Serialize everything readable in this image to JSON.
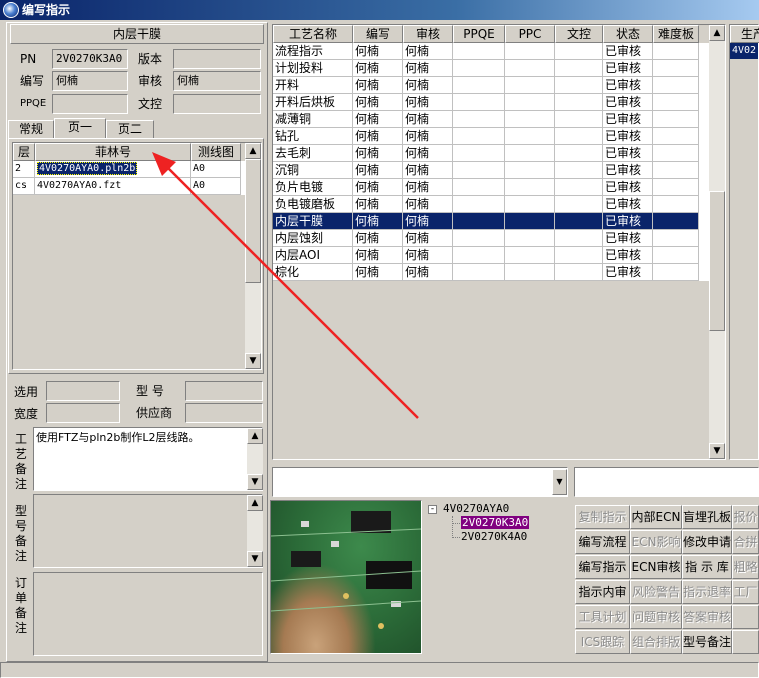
{
  "window": {
    "title": "编写指示"
  },
  "left": {
    "section_title": "内层干膜",
    "pn_label": "PN",
    "pn_value": "2V0270K3A0",
    "version_label": "版本",
    "version_value": "",
    "author_label": "编写",
    "author_value": "何楠",
    "reviewer_label": "审核",
    "reviewer_value": "何楠",
    "ppqe_label": "PPQE",
    "ppqe_value": "",
    "doc_ctrl_label": "文控",
    "doc_ctrl_value": "",
    "tabs": [
      {
        "label": "常规"
      },
      {
        "label": "页一"
      },
      {
        "label": "页二"
      }
    ],
    "film_table": {
      "headers": [
        "层",
        "菲林号",
        "测线图"
      ],
      "rows": [
        {
          "layer": "2",
          "film": "4V0270AYA0.pln2b",
          "diagram": "A0"
        },
        {
          "layer": "cs",
          "film": "4V0270AYA0.fzt",
          "diagram": "A0"
        }
      ]
    },
    "select_label": "选用",
    "select_value": "",
    "model_label": "型 号",
    "model_value": "",
    "width_label": "宽度",
    "width_value": "",
    "supplier_label": "供应商",
    "supplier_value": "",
    "process_note_label": "工艺备注",
    "process_note_text": "使用FTZ与pln2b制作L2层线路。",
    "model_note_label": "型号备注",
    "order_note_label": "订单备注"
  },
  "process_table": {
    "headers": [
      "工艺名称",
      "编写",
      "审核",
      "PPQE",
      "PPC",
      "文控",
      "状态",
      "难度板"
    ],
    "rows": [
      [
        "流程指示",
        "何楠",
        "何楠",
        "",
        "",
        "",
        "已审核",
        ""
      ],
      [
        "计划投料",
        "何楠",
        "何楠",
        "",
        "",
        "",
        "已审核",
        ""
      ],
      [
        "开料",
        "何楠",
        "何楠",
        "",
        "",
        "",
        "已审核",
        ""
      ],
      [
        "开料后烘板",
        "何楠",
        "何楠",
        "",
        "",
        "",
        "已审核",
        ""
      ],
      [
        "减薄铜",
        "何楠",
        "何楠",
        "",
        "",
        "",
        "已审核",
        ""
      ],
      [
        "钻孔",
        "何楠",
        "何楠",
        "",
        "",
        "",
        "已审核",
        ""
      ],
      [
        "去毛刺",
        "何楠",
        "何楠",
        "",
        "",
        "",
        "已审核",
        ""
      ],
      [
        "沉铜",
        "何楠",
        "何楠",
        "",
        "",
        "",
        "已审核",
        ""
      ],
      [
        "负片电镀",
        "何楠",
        "何楠",
        "",
        "",
        "",
        "已审核",
        ""
      ],
      [
        "负电镀磨板",
        "何楠",
        "何楠",
        "",
        "",
        "",
        "已审核",
        ""
      ],
      [
        "内层干膜",
        "何楠",
        "何楠",
        "",
        "",
        "",
        "已审核",
        ""
      ],
      [
        "内层蚀刻",
        "何楠",
        "何楠",
        "",
        "",
        "",
        "已审核",
        ""
      ],
      [
        "内层AOI",
        "何楠",
        "何楠",
        "",
        "",
        "",
        "已审核",
        ""
      ],
      [
        "棕化",
        "何楠",
        "何楠",
        "",
        "",
        "",
        "已审核",
        ""
      ]
    ],
    "selected_index": 10
  },
  "right_panel": {
    "header": "生产",
    "value": "4V02"
  },
  "tree": {
    "root": "4V0270AYA0",
    "children": [
      "2V0270K3A0",
      "2V0270K4A0"
    ],
    "selected": 0
  },
  "buttons": [
    {
      "label": "复制指示",
      "enabled": false
    },
    {
      "label": "内部ECN",
      "enabled": true
    },
    {
      "label": "盲埋孔板",
      "enabled": true
    },
    {
      "label": "报价",
      "enabled": false
    },
    {
      "label": "编写流程",
      "enabled": true
    },
    {
      "label": "ECN影响",
      "enabled": false
    },
    {
      "label": "修改申请",
      "enabled": true
    },
    {
      "label": "合拼",
      "enabled": false
    },
    {
      "label": "编写指示",
      "enabled": true
    },
    {
      "label": "ECN审核",
      "enabled": true
    },
    {
      "label": "指 示 库",
      "enabled": true
    },
    {
      "label": "粗略",
      "enabled": false
    },
    {
      "label": "指示内审",
      "enabled": true
    },
    {
      "label": "风险警告",
      "enabled": false
    },
    {
      "label": "指示退率",
      "enabled": false
    },
    {
      "label": "工厂",
      "enabled": false
    },
    {
      "label": "工具计划",
      "enabled": false
    },
    {
      "label": "问题审核",
      "enabled": false
    },
    {
      "label": "答案审核",
      "enabled": false
    },
    {
      "label": "",
      "enabled": false
    },
    {
      "label": "ICS跟踪",
      "enabled": false
    },
    {
      "label": "组合排版",
      "enabled": false
    },
    {
      "label": "型号备注",
      "enabled": true
    },
    {
      "label": "",
      "enabled": false
    }
  ],
  "colors": {
    "selection": "#0a246a",
    "tree_selected": "#800080",
    "annotation_arrow": "#ee2222"
  }
}
